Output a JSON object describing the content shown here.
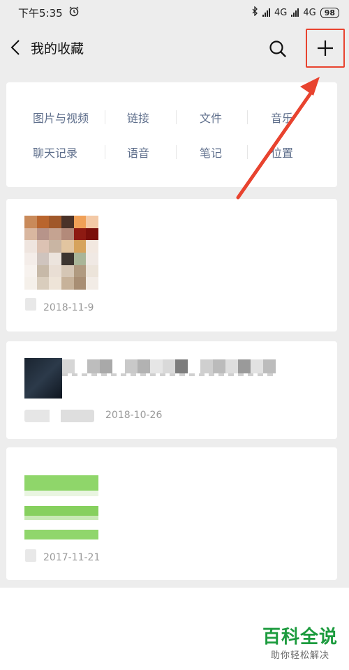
{
  "status_bar": {
    "time": "下午5:35",
    "net1": "4G",
    "net2": "4G",
    "battery": "98"
  },
  "nav": {
    "title": "我的收藏"
  },
  "categories": {
    "row1": [
      "图片与视频",
      "链接",
      "文件",
      "音乐"
    ],
    "row2": [
      "聊天记录",
      "语音",
      "笔记",
      "位置"
    ]
  },
  "favorites": [
    {
      "date": "2018-11-9"
    },
    {
      "date": "2018-10-26"
    },
    {
      "date": "2017-11-21"
    }
  ],
  "watermark": {
    "main": "百科全说",
    "sub": "助你轻松解决"
  },
  "colors": {
    "highlight": "#e8432f",
    "category_text": "#5f6f8c",
    "watermark_green": "#1c9b3e"
  }
}
